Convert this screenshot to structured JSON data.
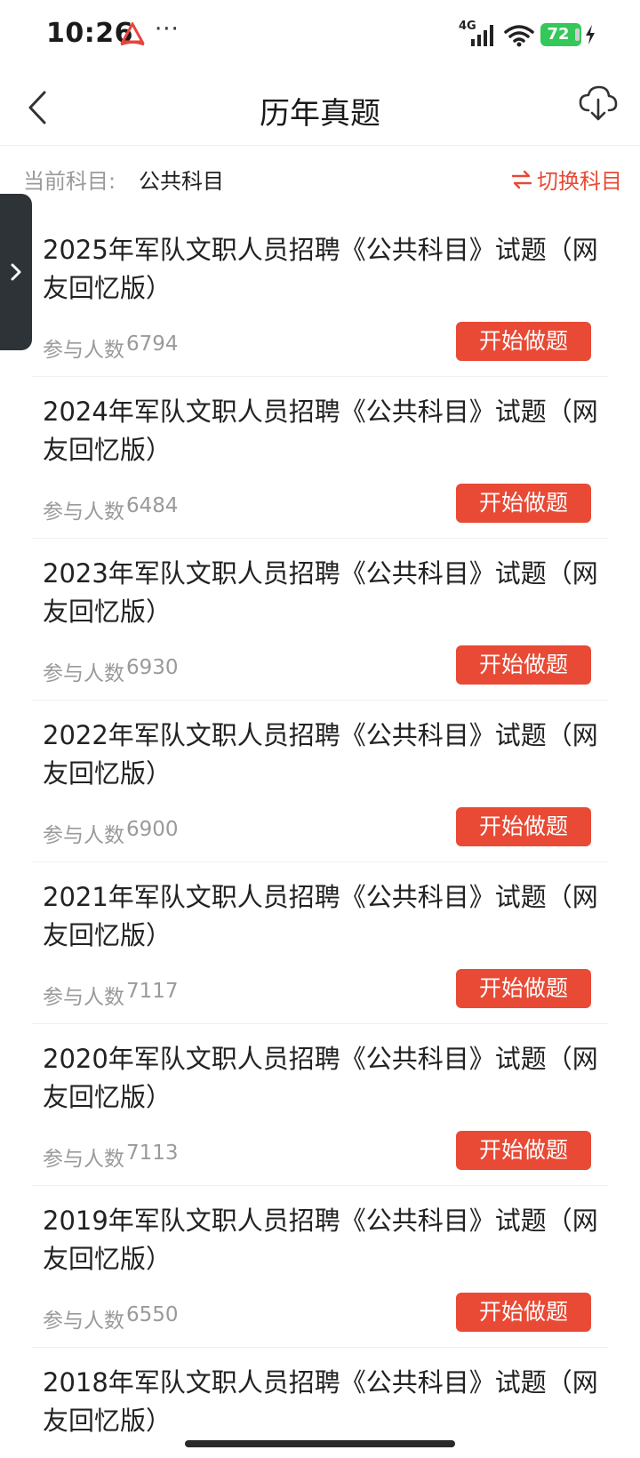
{
  "status_bar": {
    "time": "10:26",
    "more": "···",
    "network": "4G",
    "battery": "72"
  },
  "header": {
    "title": "历年真题"
  },
  "subject": {
    "label": "当前科目:",
    "value": "公共科目",
    "switch_label": "切换科目"
  },
  "exams": [
    {
      "title": "2025年军队文职人员招聘《公共科目》试题（网友回忆版）",
      "participants_label": "参与人数",
      "participants_count": "6794",
      "button": "开始做题"
    },
    {
      "title": "2024年军队文职人员招聘《公共科目》试题（网友回忆版）",
      "participants_label": "参与人数",
      "participants_count": "6484",
      "button": "开始做题"
    },
    {
      "title": "2023年军队文职人员招聘《公共科目》试题（网友回忆版）",
      "participants_label": "参与人数",
      "participants_count": "6930",
      "button": "开始做题"
    },
    {
      "title": "2022年军队文职人员招聘《公共科目》试题（网友回忆版）",
      "participants_label": "参与人数",
      "participants_count": "6900",
      "button": "开始做题"
    },
    {
      "title": "2021年军队文职人员招聘《公共科目》试题（网友回忆版）",
      "participants_label": "参与人数",
      "participants_count": "7117",
      "button": "开始做题"
    },
    {
      "title": "2020年军队文职人员招聘《公共科目》试题（网友回忆版）",
      "participants_label": "参与人数",
      "participants_count": "7113",
      "button": "开始做题"
    },
    {
      "title": "2019年军队文职人员招聘《公共科目》试题（网友回忆版）",
      "participants_label": "参与人数",
      "participants_count": "6550",
      "button": "开始做题"
    },
    {
      "title": "2018年军队文职人员招聘《公共科目》试题（网友回忆版）",
      "participants_label": "参与人数",
      "participants_count": "",
      "button": ""
    }
  ],
  "colors": {
    "accent": "#e84a35",
    "muted_text": "#9a9a9a",
    "battery": "#34c759",
    "side_handle": "#2e3338"
  },
  "icons": {
    "back": "chevron-left-icon",
    "download": "cloud-download-icon",
    "switch": "swap-arrows-icon",
    "side_handle": "chevron-right-icon"
  }
}
